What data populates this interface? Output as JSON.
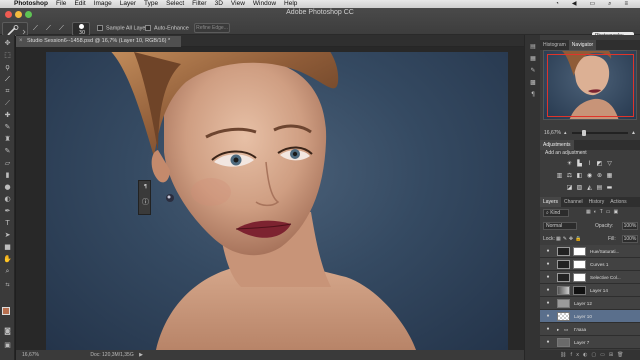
{
  "menubar": {
    "apple": "",
    "items": [
      "Photoshop",
      "File",
      "Edit",
      "Image",
      "Layer",
      "Type",
      "Select",
      "Filter",
      "3D",
      "View",
      "Window",
      "Help"
    ]
  },
  "options": {
    "app_title": "Adobe Photoshop CC",
    "brush_size": "30",
    "sample_all_layers": "Sample All Layers",
    "auto_enhance": "Auto-Enhance",
    "refine_edge": "Refine Edge...",
    "workspace": "Photography"
  },
  "document": {
    "tab_title": "Studio Session6--1458.psd @ 16,7% (Layer 10, RGB/16) *"
  },
  "status": {
    "zoom": "16,67%",
    "doc": "Doc: 120,3M/1,35G"
  },
  "panels": {
    "top_tabs": [
      "Histogram",
      "Navigator"
    ],
    "nav_zoom": "16,67%",
    "adjustments_tab": "Adjustments",
    "add_adjustment": "Add an adjustment",
    "layer_tabs": [
      "Layers",
      "Channel",
      "History",
      "Actions"
    ],
    "kind": "Kind",
    "blend": "Normal",
    "opacity_label": "Opacity:",
    "opacity": "100%",
    "lock_label": "Lock:",
    "fill_label": "Fill:",
    "fill": "100%",
    "layers": [
      {
        "name": "Hue/Saturati..."
      },
      {
        "name": "Curves 1"
      },
      {
        "name": "Selective Col..."
      },
      {
        "name": "Layer 14"
      },
      {
        "name": "Layer 12"
      },
      {
        "name": "Layer 10"
      },
      {
        "name": "Глаза"
      },
      {
        "name": "Layer 7"
      }
    ]
  },
  "colors": {
    "accent": "#e0342a",
    "selected_layer": "#5a6f8c",
    "background": "#4a6078"
  }
}
